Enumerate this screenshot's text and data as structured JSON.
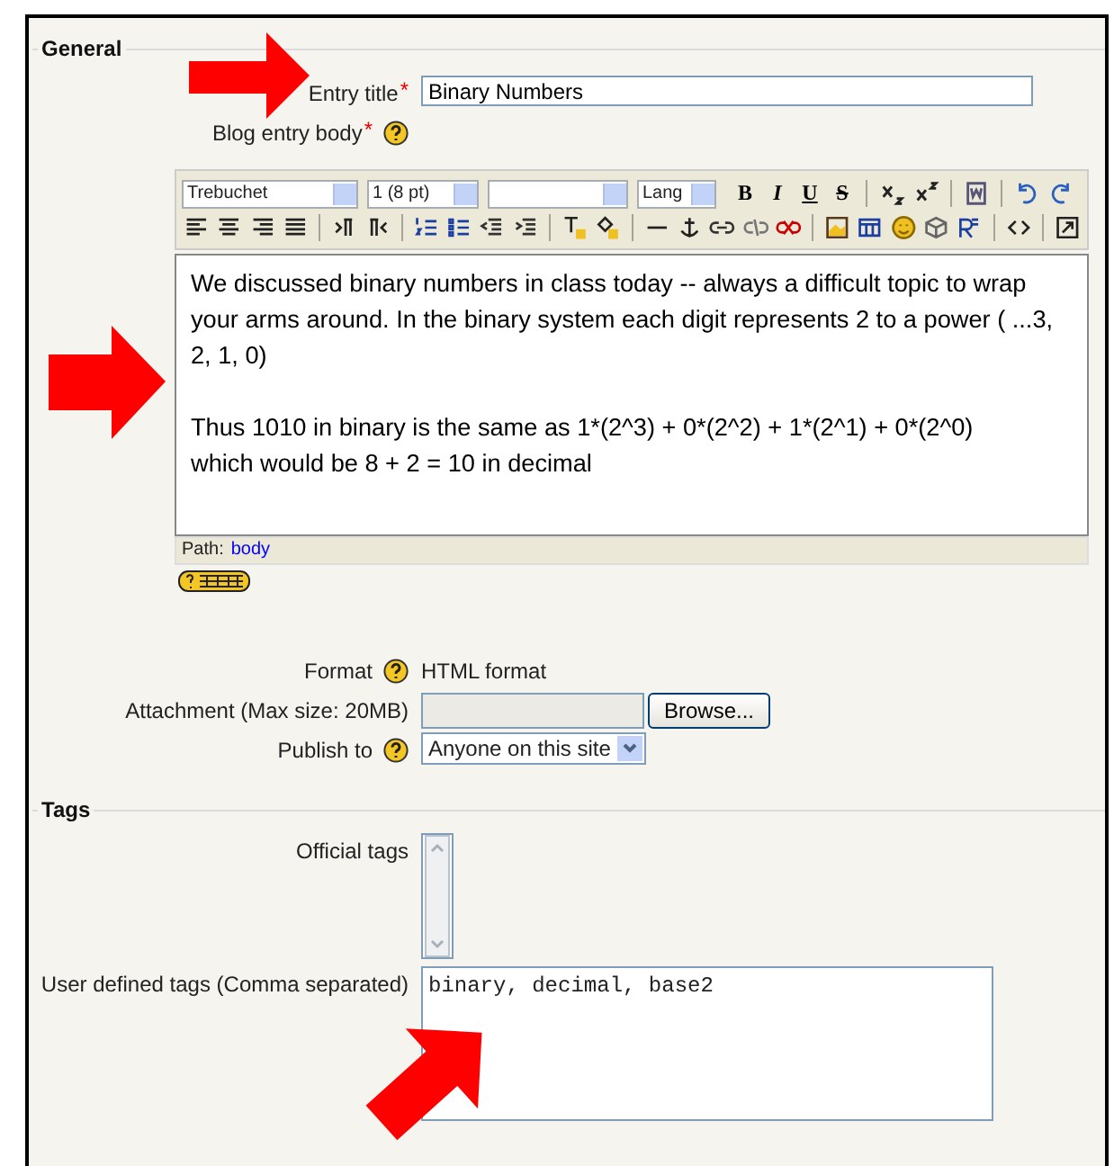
{
  "sections": [
    {
      "legend": "General",
      "rows": [
        {
          "kind": "text",
          "label": "Entry title",
          "required_mark": "*",
          "help": false,
          "value": "Binary Numbers"
        },
        {
          "kind": "editor",
          "label": "Blog entry body",
          "required_mark": "*",
          "help": true,
          "editor": {
            "font": "Trebuchet",
            "size": "1 (8 pt)",
            "lang": "Lang",
            "style_buttons": [
              "B",
              "I",
              "U",
              "S"
            ],
            "paragraphs": [
              "We discussed binary numbers in class today -- always a difficult topic to wrap your arms around. In the binary system each digit represents 2 to a power ( ...3, 2, 1, 0)",
              "Thus 1010 in binary is the same as 1*(2^3) + 0*(2^2) + 1*(2^1) + 0*(2^0)\nwhich would be 8 + 2 = 10 in decimal"
            ],
            "path_label": "Path:",
            "path_link": "body"
          }
        },
        {
          "kind": "static",
          "label": "Format",
          "help": true,
          "value": "HTML format"
        },
        {
          "kind": "file",
          "label": "Attachment (Max size: 20MB)",
          "help": false,
          "button": "Browse..."
        },
        {
          "kind": "select",
          "label": "Publish to",
          "help": true,
          "value": "Anyone on this site"
        }
      ]
    },
    {
      "legend": "Tags",
      "rows": [
        {
          "kind": "listbox",
          "label": "Official tags",
          "help": false
        },
        {
          "kind": "textarea",
          "label": "User defined tags (Comma separated)",
          "help": false,
          "value": "binary, decimal, base2"
        }
      ]
    }
  ]
}
